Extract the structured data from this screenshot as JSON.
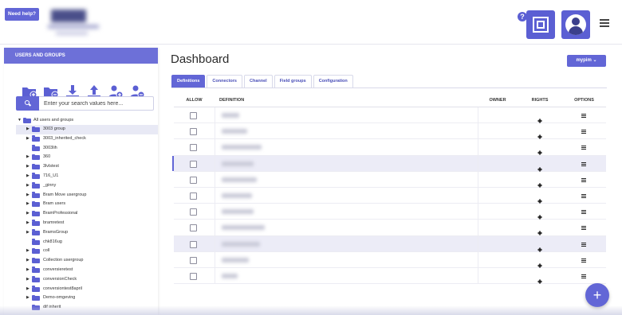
{
  "topbar": {
    "need_help": "Need help?",
    "help_icon": "?"
  },
  "sidebar": {
    "header": "USERS AND GROUPS",
    "tools": [
      "add-folder-icon",
      "remove-folder-icon",
      "download-icon",
      "upload-icon",
      "add-user-icon",
      "remove-user-icon"
    ],
    "search_placeholder": "Enter your search values here...",
    "tree_root": "All users and groups",
    "items": [
      {
        "label": "3003 group",
        "has_children": true,
        "selected": true
      },
      {
        "label": "3003_inherited_check",
        "has_children": true,
        "selected": false
      },
      {
        "label": "3003lih",
        "has_children": false,
        "selected": false
      },
      {
        "label": "360",
        "has_children": true,
        "selected": false
      },
      {
        "label": "3lvlstest",
        "has_children": true,
        "selected": false
      },
      {
        "label": "716_U1",
        "has_children": true,
        "selected": false
      },
      {
        "label": "_ginny",
        "has_children": true,
        "selected": false
      },
      {
        "label": "Bram Move usergroup",
        "has_children": true,
        "selected": false
      },
      {
        "label": "Bram users",
        "has_children": true,
        "selected": false
      },
      {
        "label": "BramProfessional",
        "has_children": true,
        "selected": false
      },
      {
        "label": "bramretest",
        "has_children": true,
        "selected": false
      },
      {
        "label": "BramsGroup",
        "has_children": true,
        "selected": false
      },
      {
        "label": "chk816ug",
        "has_children": false,
        "selected": false
      },
      {
        "label": "coll",
        "has_children": true,
        "selected": false
      },
      {
        "label": "Collection usergroup",
        "has_children": true,
        "selected": false
      },
      {
        "label": "conversieretest",
        "has_children": true,
        "selected": false
      },
      {
        "label": "conversionCheck",
        "has_children": true,
        "selected": false
      },
      {
        "label": "conversiontest8april",
        "has_children": true,
        "selected": false
      },
      {
        "label": "Demo-omgeving",
        "has_children": true,
        "selected": false
      },
      {
        "label": "dif inherit",
        "has_children": false,
        "selected": false
      }
    ]
  },
  "main": {
    "title": "Dashboard",
    "user_button": "mypim ⌄",
    "tabs": [
      "Definitions",
      "Connectors",
      "Channel",
      "Field groups",
      "Configuration"
    ],
    "active_tab": "Definitions",
    "columns": {
      "allow": "ALLOW",
      "definition": "DEFINITION",
      "owner": "OWNER",
      "rights": "RIGHTS",
      "options": "OPTIONS"
    },
    "rows": [
      {
        "highlight": false,
        "marked": false
      },
      {
        "highlight": false,
        "marked": false
      },
      {
        "highlight": false,
        "marked": false
      },
      {
        "highlight": true,
        "marked": true
      },
      {
        "highlight": false,
        "marked": false
      },
      {
        "highlight": false,
        "marked": false
      },
      {
        "highlight": false,
        "marked": false
      },
      {
        "highlight": false,
        "marked": false
      },
      {
        "highlight": true,
        "marked": false
      },
      {
        "highlight": false,
        "marked": false
      },
      {
        "highlight": false,
        "marked": false
      }
    ]
  },
  "fab": {
    "label": "+"
  },
  "colors": {
    "accent": "#6266d6",
    "sidebar_header": "#6d70d8",
    "row_highlight": "#ececf7"
  }
}
